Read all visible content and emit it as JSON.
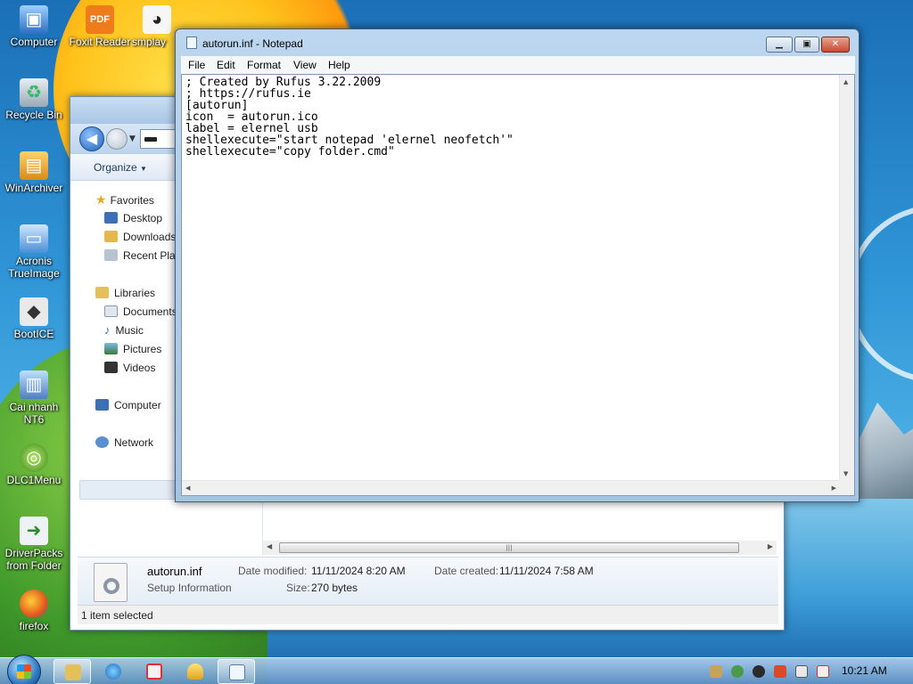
{
  "desktop": {
    "icons": [
      {
        "label": "Computer",
        "icon": "computer-icon"
      },
      {
        "label": "Foxit Reader",
        "icon": "pdf-icon"
      },
      {
        "label": "smplay",
        "icon": "penguin-icon"
      },
      {
        "label": "Recycle Bin",
        "icon": "recycle-bin-icon"
      },
      {
        "label": "WinArchiver",
        "icon": "archive-icon"
      },
      {
        "label": "Acronis TrueImage",
        "icon": "acronis-icon"
      },
      {
        "label": "BootICE",
        "icon": "bootice-icon"
      },
      {
        "label": "Cai nhanh NT6",
        "icon": "installer-icon"
      },
      {
        "label": "DLC1Menu",
        "icon": "dlc-icon"
      },
      {
        "label": "DriverPacks from Folder",
        "icon": "driverpack-icon"
      },
      {
        "label": "firefox",
        "icon": "firefox-icon"
      }
    ]
  },
  "explorer": {
    "organize_label": "Organize",
    "favorites": {
      "header": "Favorites",
      "items": [
        "Desktop",
        "Downloads",
        "Recent Plac"
      ]
    },
    "libraries": {
      "header": "Libraries",
      "items": [
        "Documents",
        "Music",
        "Pictures",
        "Videos"
      ]
    },
    "computer_label": "Computer",
    "network_label": "Network",
    "details": {
      "file_name": "autorun.inf",
      "file_type": "Setup Information",
      "date_modified_label": "Date modified:",
      "date_modified": "11/11/2024 8:20 AM",
      "date_created_label": "Date created:",
      "date_created": "11/11/2024 7:58 AM",
      "size_label": "Size:",
      "size": "270 bytes"
    },
    "status": "1 item selected"
  },
  "notepad": {
    "title": "autorun.inf - Notepad",
    "menu": [
      "File",
      "Edit",
      "Format",
      "View",
      "Help"
    ],
    "content": "; Created by Rufus 3.22.2009\n; https://rufus.ie\n[autorun]\nicon  = autorun.ico\nlabel = elernel usb\nshellexecute=\"start notepad 'elernel neofetch'\"\nshellexecute=\"copy folder.cmd\""
  },
  "taskbar": {
    "clock": "10:21 AM",
    "pinned": [
      "explorer-icon",
      "internet-explorer-icon",
      "network-tool-icon",
      "winamp-icon",
      "notepad-icon"
    ],
    "tray": [
      "tray-tool-icon",
      "tray-safe-icon",
      "tray-play-icon",
      "tray-cmd-icon",
      "tray-monitor-icon",
      "tray-volume-mute-icon"
    ]
  }
}
